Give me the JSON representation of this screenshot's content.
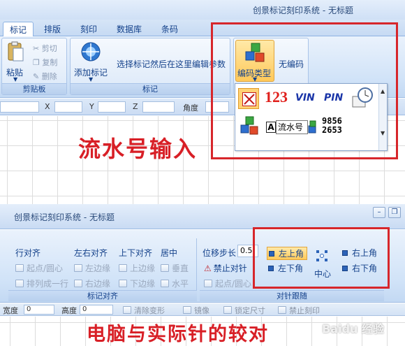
{
  "top": {
    "window_title": "创景标记刻印系统 - 无标题",
    "tabs": [
      "标记",
      "排版",
      "刻印",
      "数据库",
      "条码"
    ],
    "clipboard": {
      "paste": "粘贴",
      "cut": "剪切",
      "copy": "复制",
      "delete": "删除",
      "group": "剪贴板"
    },
    "mark": {
      "add": "添加标记",
      "hint": "选择标记然后在这里编辑参数",
      "group": "标记"
    },
    "code": {
      "type": "编码类型",
      "none": "无编码"
    },
    "coords": {
      "x": "X",
      "y": "Y",
      "z": "Z",
      "angle": "角度"
    },
    "popup": {
      "n123": "123",
      "vin": "VIN",
      "pin": "PIN",
      "a": "A",
      "tooltip": "流水号",
      "num1": "9856",
      "num2": "2653"
    },
    "annotation": "流水号输入"
  },
  "bottom": {
    "window_title": "创景标记刻印系统 - 无标题",
    "align": {
      "row_align": "行对齐",
      "lr_align": "左右对齐",
      "ud_align": "上下对齐",
      "center": "居中",
      "start_center": "起点/圆心",
      "left_edge": "左边缘",
      "top_edge": "上边缘",
      "vertical": "垂直",
      "arrange_row": "排列成一行",
      "right_edge": "右边缘",
      "bottom_edge": "下边缘",
      "horizontal": "水平",
      "group": "标记对齐"
    },
    "needle": {
      "step_label": "位移步长",
      "step_value": "0.5",
      "forbid": "禁止对针",
      "start_center": "起点/圆心",
      "top_left": "左上角",
      "bottom_left": "左下角",
      "center": "中心",
      "top_right": "右上角",
      "bottom_right": "右下角",
      "group": "对针跟随"
    },
    "status": {
      "width": "宽度",
      "width_val": "0",
      "height": "高度",
      "height_val": "0",
      "clear": "清除变形",
      "mirror": "镜像",
      "lock": "锁定尺寸",
      "forbid": "禁止刻印"
    },
    "annotation": "电脑与实际针的较对",
    "watermark": "Baidu 经验"
  }
}
